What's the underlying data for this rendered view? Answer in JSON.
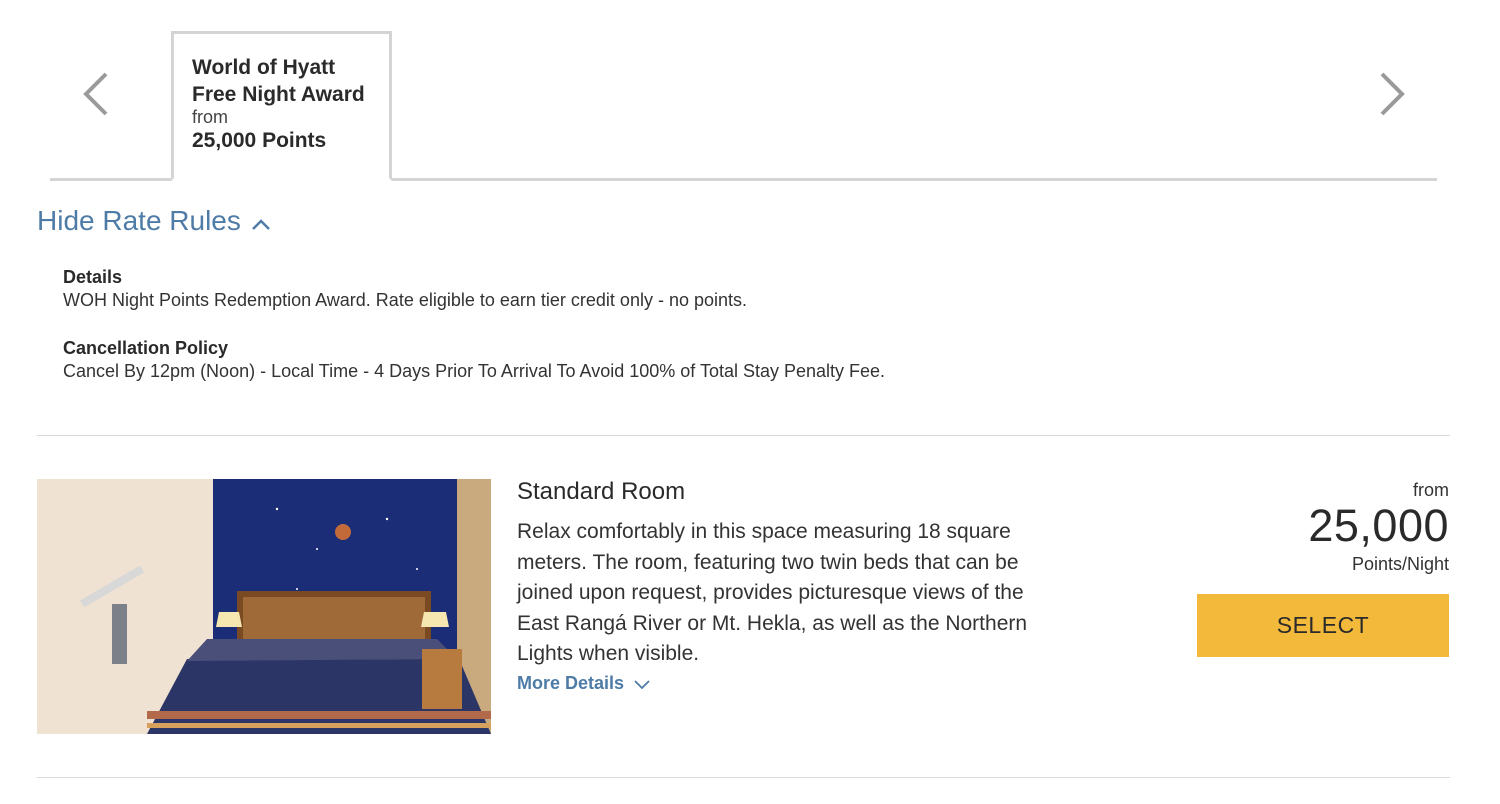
{
  "rate_tabs": {
    "active_tab": {
      "title": "World of Hyatt Free Night Award",
      "from_label": "from",
      "points": "25,000 Points"
    },
    "prev_icon": "chevron-left-icon",
    "next_icon": "chevron-right-icon"
  },
  "rate_rules": {
    "toggle_label": "Hide Rate Rules",
    "toggle_icon": "chevron-up-icon",
    "details_label": "Details",
    "details_text": "WOH Night Points Redemption Award. Rate eligible to earn tier credit only - no points.",
    "cancellation_label": "Cancellation Policy",
    "cancellation_text": "Cancel By 12pm (Noon) - Local Time - 4 Days Prior To Arrival To Avoid 100% of Total Stay Penalty Fee."
  },
  "room": {
    "title": "Standard Room",
    "description": "Relax comfortably in this space measuring 18 square meters. The room, featuring two twin beds that can be joined upon request, provides picturesque views of the East Rangá River or Mt. Hekla, as well as the Northern Lights when visible.",
    "more_details_label": "More Details",
    "more_details_icon": "chevron-down-icon",
    "price_from": "from",
    "price_amount": "25,000",
    "price_unit": "Points/Night",
    "select_label": "SELECT"
  },
  "colors": {
    "link_blue": "#4f7ca7",
    "select_yellow": "#f2b93b",
    "border_gray": "#d4d4d4"
  }
}
